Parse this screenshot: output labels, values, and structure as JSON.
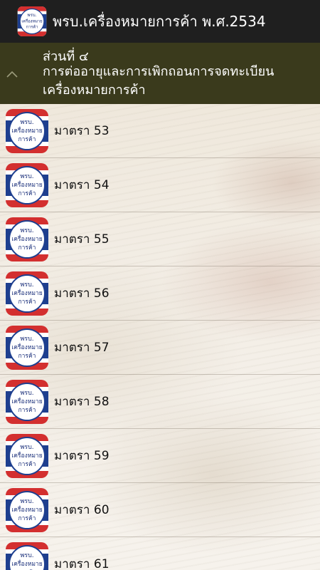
{
  "app": {
    "title": "พรบ.เครื่องหมายการค้า พ.ศ.2534",
    "icon_name": "trademark-act-icon",
    "icon_text_lines": [
      "พรบ.",
      "เครื่องหมาย",
      "การค้า"
    ]
  },
  "section": {
    "number": "ส่วนที่ ๔",
    "title": "การต่ออายุและการเพิกถอนการจดทะเบียนเครื่องหมายการค้า",
    "toggle_icon": "chevron-up-icon"
  },
  "items": [
    {
      "label": "มาตรา 53"
    },
    {
      "label": "มาตรา 54"
    },
    {
      "label": "มาตรา 55"
    },
    {
      "label": "มาตรา 56"
    },
    {
      "label": "มาตรา 57"
    },
    {
      "label": "มาตรา 58"
    },
    {
      "label": "มาตรา 59"
    },
    {
      "label": "มาตรา 60"
    },
    {
      "label": "มาตรา 61"
    }
  ],
  "colors": {
    "action_bar": "#1f1f1f",
    "section_header": "#3a3a1c",
    "icon_ring_red": "#d32f2f",
    "icon_ring_blue": "#1e3f8f",
    "icon_text": "#1a2f7a"
  }
}
